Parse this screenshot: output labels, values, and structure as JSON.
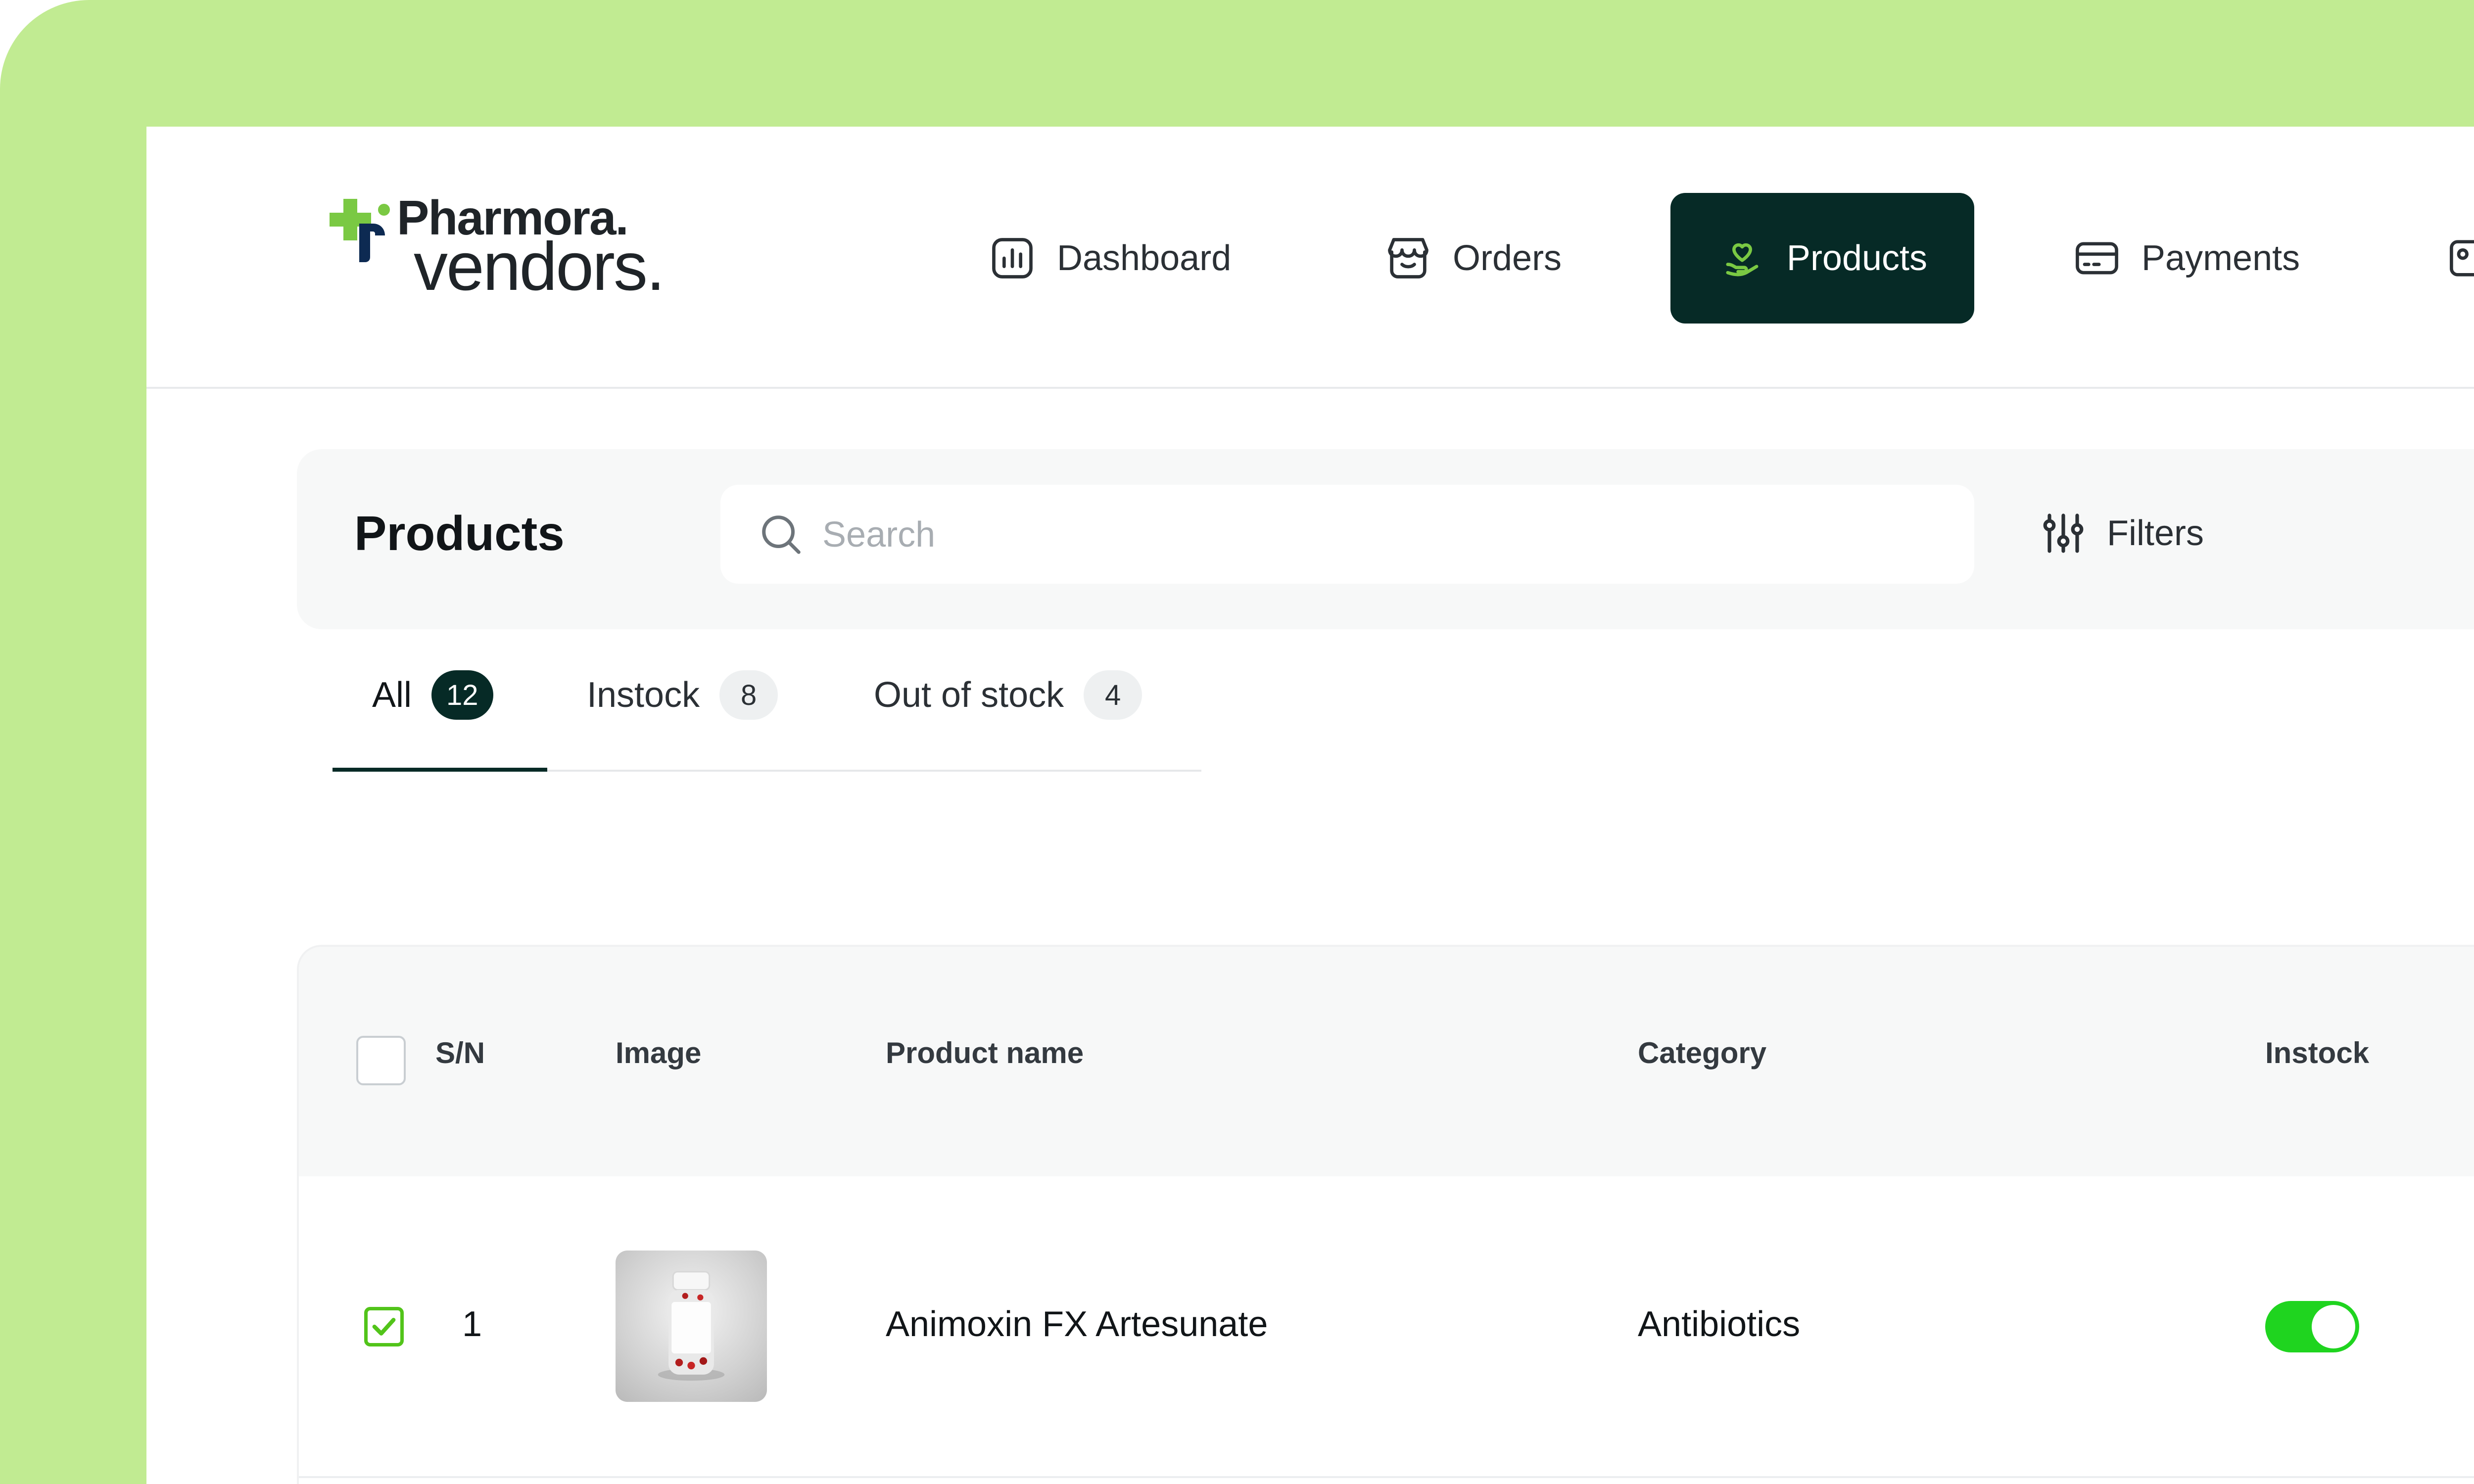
{
  "brand": {
    "line1": "Pharmora.",
    "line2": "vendors.",
    "colors": {
      "green": "#7ac943",
      "navy": "#0d2a52",
      "accent": "#062a26"
    }
  },
  "nav": {
    "items": [
      {
        "label": "Dashboard",
        "icon": "bar-chart-icon"
      },
      {
        "label": "Orders",
        "icon": "store-icon"
      },
      {
        "label": "Products",
        "icon": "heart-hand-icon",
        "active": true
      },
      {
        "label": "Payments",
        "icon": "card-icon"
      }
    ]
  },
  "toolbar": {
    "title": "Products",
    "search_placeholder": "Search",
    "filters_label": "Filters"
  },
  "tabs": [
    {
      "label": "All",
      "count": "12",
      "active": true
    },
    {
      "label": "Instock",
      "count": "8"
    },
    {
      "label": "Out of stock",
      "count": "4"
    }
  ],
  "table": {
    "columns": [
      "S/N",
      "Image",
      "Product name",
      "Category",
      "Instock"
    ],
    "rows": [
      {
        "sn": "1",
        "name": "Animoxin FX Artesunate",
        "category": "Antibiotics",
        "checked": true,
        "instock": true
      }
    ]
  }
}
